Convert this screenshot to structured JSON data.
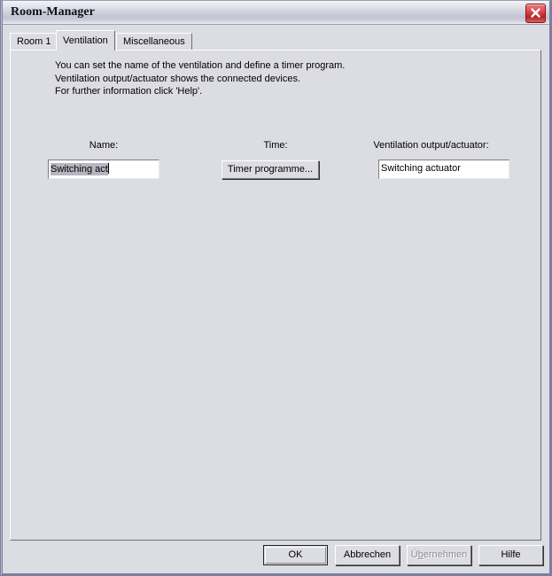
{
  "window": {
    "title": "Room-Manager",
    "close_icon": "close-icon",
    "accent_close_color": "#c0392b",
    "background_color": "#dcdce3"
  },
  "tabs": [
    {
      "label": "Room 1",
      "selected": false
    },
    {
      "label": "Ventilation",
      "selected": true
    },
    {
      "label": "Miscellaneous",
      "selected": false
    }
  ],
  "page": {
    "description": [
      "You can set the name of the ventilation and define a timer program.",
      "Ventilation output/actuator shows the connected devices.",
      "For further information click 'Help'."
    ],
    "fields": {
      "name": {
        "label": "Name:",
        "value": "Switching act",
        "selected_text": "Switching act"
      },
      "time": {
        "label": "Time:",
        "button_label": "Timer programme..."
      },
      "output": {
        "label": "Ventilation output/actuator:",
        "value": "Switching actuator"
      }
    }
  },
  "footer": {
    "ok": "OK",
    "cancel": "Abbrechen",
    "apply_prefix": "Ü",
    "apply_mnemonic": "b",
    "apply_suffix": "ernehmen",
    "apply_full": "Übernehmen",
    "help": "Hilfe"
  }
}
